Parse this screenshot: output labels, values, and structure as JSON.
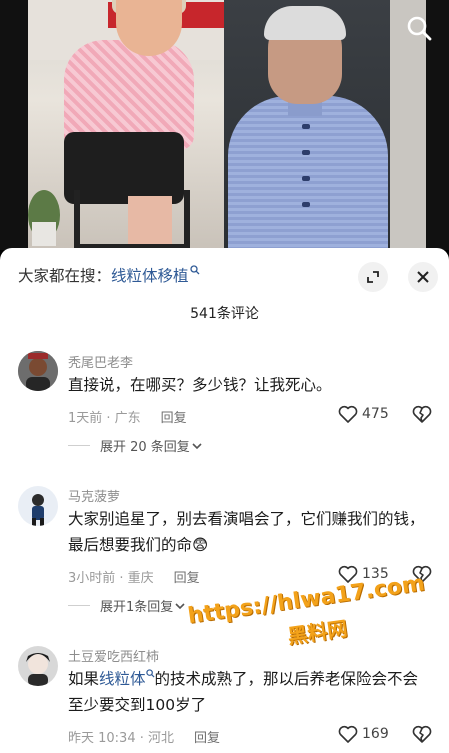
{
  "search_bar": {
    "prefix": "大家都在搜：",
    "keyword": "线粒体移植"
  },
  "comment_count": "541条评论",
  "comments": [
    {
      "name": "秃尾巴老李",
      "text": "直接说，在哪买？多少钱？让我死心。",
      "meta": "1天前 · 广东",
      "reply": "回复",
      "likes": "475",
      "expand": "展开 20 条回复"
    },
    {
      "name": "马克菠萝",
      "text": "大家别追星了，别去看演唱会了，它们赚我们的钱，最后想要我们的命😨",
      "meta": "3小时前 · 重庆",
      "reply": "回复",
      "likes": "135",
      "expand": "展开1条回复"
    },
    {
      "name": "土豆爱吃西红柿",
      "text_pre": "如果",
      "text_kw": "线粒体",
      "text_post": "的技术成熟了，那以后养老保险会不会至少要交到100岁了",
      "meta": "昨天 10:34 · 河北",
      "reply": "回复",
      "likes": "169"
    }
  ],
  "watermark": {
    "url": "https://hlwa17.com",
    "cn": "黑料网"
  },
  "colors": {
    "keyword": "#2f5a96",
    "watermark": "#f3a21a"
  }
}
